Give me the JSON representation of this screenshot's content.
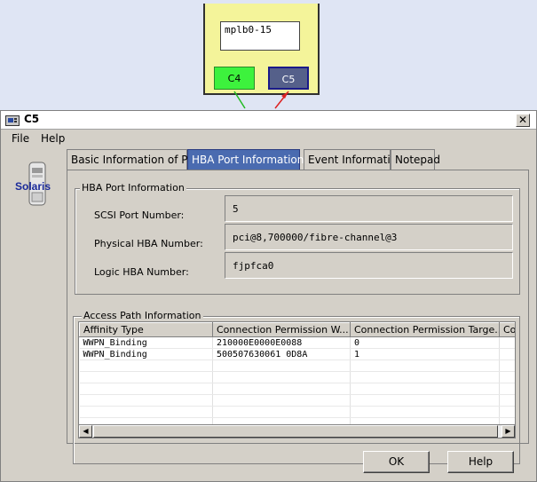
{
  "diagram": {
    "device_label": "mplb0-15",
    "ports": [
      {
        "label": "C4",
        "color": "#3df23d",
        "link_color": "#22bb22"
      },
      {
        "label": "C5",
        "color": "#55608a",
        "link_color": "#dd2222"
      }
    ]
  },
  "dialog": {
    "title": "C5",
    "close_glyph": "✕",
    "menu": [
      "File",
      "Help"
    ],
    "os_label": "Solaris",
    "tabs": [
      "Basic Information of Port",
      "HBA Port Information",
      "Event Information",
      "Notepad"
    ],
    "active_tab": "HBA Port Information",
    "hba_section": {
      "title": "HBA Port Information",
      "fields": [
        {
          "label": "SCSI Port Number:",
          "value": "5"
        },
        {
          "label": "Physical HBA Number:",
          "value": "pci@8,700000/fibre-channel@3"
        },
        {
          "label": "Logic HBA Number:",
          "value": "fjpfca0"
        }
      ]
    },
    "access_path": {
      "title": "Access Path Information",
      "columns": [
        "Affinity Type",
        "Connection Permission W...",
        "Connection Permission Targe...",
        "Co"
      ],
      "rows": [
        [
          "WWPN_Binding",
          "210000E0000E0088",
          "0",
          ""
        ],
        [
          "WWPN_Binding",
          "500507630061 0D8A",
          "1",
          ""
        ]
      ],
      "empty_rows": 6
    },
    "buttons": {
      "ok": "OK",
      "help": "Help"
    }
  }
}
